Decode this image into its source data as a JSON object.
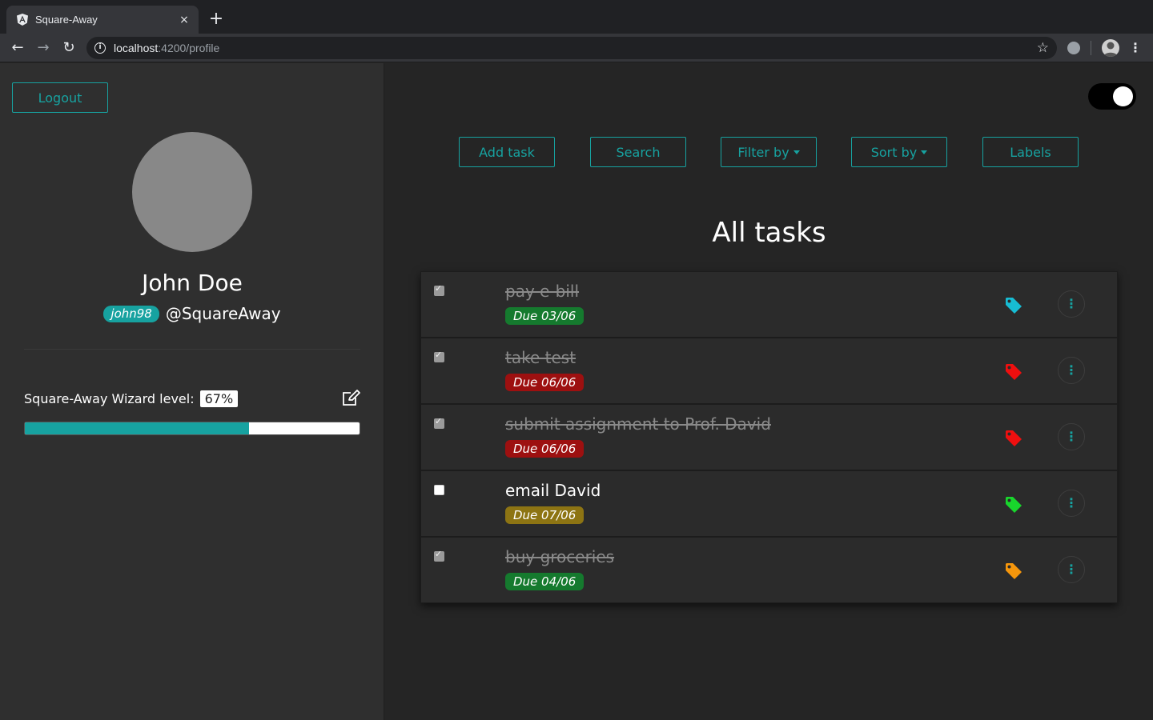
{
  "browser": {
    "tab_title": "Square-Away",
    "tab_close": "×",
    "new_tab": "+",
    "url_host": "localhost",
    "url_path": ":4200/profile",
    "back": "←",
    "forward": "→",
    "reload": "↻",
    "star": "☆",
    "menu": "⋮"
  },
  "sidebar": {
    "logout_label": "Logout",
    "user_name": "John Doe",
    "handle_badge": "john98",
    "handle_text": "@SquareAway",
    "level_label": "Square-Away Wizard level:",
    "level_percent_text": "67%",
    "level_value": 0.67
  },
  "main": {
    "theme_toggle_on": true,
    "actions": {
      "add_task": "Add task",
      "search": "Search",
      "filter_by": "Filter by",
      "sort_by": "Sort by",
      "labels": "Labels"
    },
    "section_title": "All tasks",
    "tasks": [
      {
        "title": "pay e-bill",
        "due": "Due 03/06",
        "done": true,
        "due_color": "#157a2e",
        "tag_color": "#17bcd3"
      },
      {
        "title": "take test",
        "due": "Due 06/06",
        "done": true,
        "due_color": "#9d1010",
        "tag_color": "#ef0f0f"
      },
      {
        "title": "submit assignment to Prof. David",
        "due": "Due 06/06",
        "done": true,
        "due_color": "#9d1010",
        "tag_color": "#ef0f0f"
      },
      {
        "title": "email David",
        "due": "Due 07/06",
        "done": false,
        "due_color": "#8d7413",
        "tag_color": "#18d62c"
      },
      {
        "title": "buy groceries",
        "due": "Due 04/06",
        "done": true,
        "due_color": "#157a2e",
        "tag_color": "#f5960c"
      }
    ]
  },
  "colors": {
    "accent": "#17a2a0",
    "sidebar_bg": "#2f2f2f",
    "main_bg": "#252525"
  }
}
